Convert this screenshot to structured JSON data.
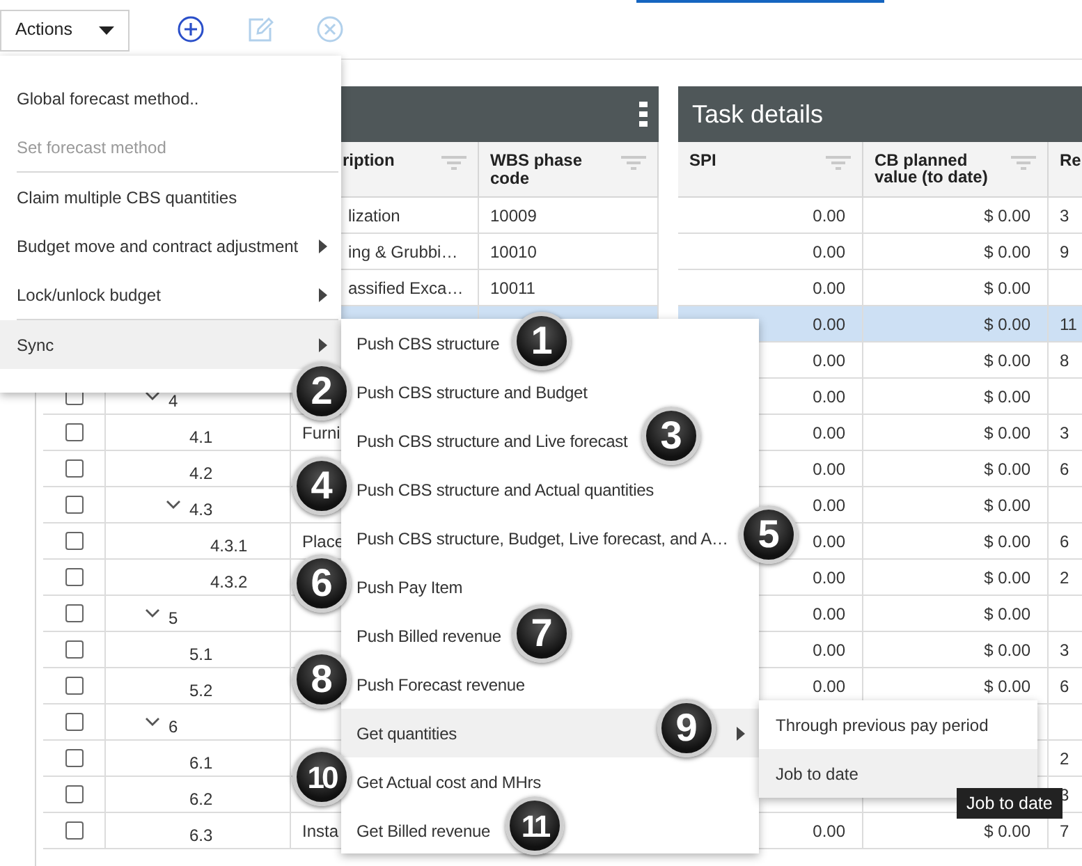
{
  "toolbar": {
    "actions_label": "Actions",
    "icons": [
      {
        "kind": "add",
        "disabled": false
      },
      {
        "kind": "edit",
        "disabled": true
      },
      {
        "kind": "remove",
        "disabled": true
      }
    ]
  },
  "cbs_panel": {
    "columns": [
      {
        "label": "ription",
        "filter": true
      },
      {
        "label": "WBS phase code",
        "filter": true
      }
    ],
    "rows": [
      {
        "description": "lization",
        "code": "10009"
      },
      {
        "description": "ing & Grubbi…",
        "code": "10010"
      },
      {
        "description": "assified Exca…",
        "code": "10011"
      },
      {},
      {},
      {
        "wbs": "4",
        "expanded": true,
        "checked": false,
        "children": [
          {
            "wbs": "4.1",
            "description": "Furni",
            "checked": false
          },
          {
            "wbs": "4.2",
            "checked": false
          },
          {
            "wbs": "4.3",
            "expanded": true,
            "checked": false,
            "children": [
              {
                "wbs": "4.3.1",
                "description": "Place",
                "checked": false
              },
              {
                "wbs": "4.3.2",
                "checked": false
              }
            ]
          }
        ]
      },
      {
        "wbs": "5",
        "expanded": true,
        "checked": false,
        "children": [
          {
            "wbs": "5.1",
            "checked": false
          },
          {
            "wbs": "5.2",
            "checked": false
          }
        ]
      },
      {
        "wbs": "6",
        "expanded": true,
        "checked": false,
        "children": [
          {
            "wbs": "6.1",
            "checked": false
          },
          {
            "wbs": "6.2",
            "checked": false
          },
          {
            "wbs": "6.3",
            "description": "Insta",
            "checked": false
          }
        ]
      }
    ]
  },
  "task_panel": {
    "title": "Task details",
    "columns": [
      {
        "label": "SPI",
        "filter": true
      },
      {
        "label": "CB planned value (to date)",
        "filter": true
      },
      {
        "label": "Re",
        "filter": false
      }
    ],
    "rows": [
      {
        "spi": "0.00",
        "planned": "$ 0.00",
        "re": "3",
        "selected": false
      },
      {
        "spi": "0.00",
        "planned": "$ 0.00",
        "re": "9",
        "selected": false
      },
      {
        "spi": "0.00",
        "planned": "$ 0.00",
        "selected": false
      },
      {
        "spi": "0.00",
        "planned": "$ 0.00",
        "re": "11",
        "selected": true
      },
      {
        "spi": "0.00",
        "planned": "$ 0.00",
        "re": "8",
        "selected": false
      },
      {
        "spi": "0.00",
        "planned": "$ 0.00",
        "selected": false
      },
      {
        "spi": "0.00",
        "planned": "$ 0.00",
        "re": "3",
        "selected": false
      },
      {
        "spi": "0.00",
        "planned": "$ 0.00",
        "re": "6",
        "selected": false
      },
      {
        "spi": "0.00",
        "planned": "$ 0.00",
        "selected": false
      },
      {
        "spi": "0.00",
        "planned": "$ 0.00",
        "re": "6",
        "selected": false
      },
      {
        "spi": "0.00",
        "planned": "$ 0.00",
        "re": "2",
        "selected": false
      },
      {
        "spi": "0.00",
        "planned": "$ 0.00",
        "selected": false
      },
      {
        "spi": "0.00",
        "planned": "$ 0.00",
        "re": "3",
        "selected": false
      },
      {
        "spi": "0.00",
        "planned": "$ 0.00",
        "re": "6",
        "selected": false
      },
      {
        "selected": false
      },
      {
        "re": "2",
        "selected": false
      },
      {
        "re": "3",
        "selected": false
      },
      {
        "spi": "0.00",
        "planned": "$ 0.00",
        "re": "7",
        "selected": false
      }
    ]
  },
  "actions_menu": {
    "items": [
      {
        "kind": "item",
        "label": "Global forecast method..",
        "disabled": false,
        "submenu": false,
        "highlighted": false
      },
      {
        "kind": "item",
        "label": "Set forecast method",
        "disabled": true,
        "submenu": false,
        "highlighted": false
      },
      {
        "kind": "divider"
      },
      {
        "kind": "item",
        "label": "Claim multiple CBS quantities",
        "disabled": false,
        "submenu": false,
        "highlighted": false
      },
      {
        "kind": "item",
        "label": "Budget move and contract adjustment",
        "disabled": false,
        "submenu": true,
        "highlighted": false
      },
      {
        "kind": "item",
        "label": "Lock/unlock budget",
        "disabled": false,
        "submenu": true,
        "highlighted": false
      },
      {
        "kind": "divider"
      },
      {
        "kind": "item",
        "label": "Sync",
        "disabled": false,
        "submenu": true,
        "highlighted": true
      }
    ]
  },
  "sync_menu": {
    "items": [
      {
        "label": "Push CBS structure",
        "submenu": false,
        "highlighted": false
      },
      {
        "label": "Push CBS structure and Budget",
        "submenu": false,
        "highlighted": false
      },
      {
        "label": "Push CBS structure and Live forecast",
        "submenu": false,
        "highlighted": false
      },
      {
        "label": "Push CBS structure and Actual quantities",
        "submenu": false,
        "highlighted": false
      },
      {
        "label": "Push CBS structure, Budget, Live forecast, and A…",
        "submenu": false,
        "highlighted": false
      },
      {
        "label": "Push Pay Item",
        "submenu": false,
        "highlighted": false
      },
      {
        "label": "Push Billed revenue",
        "submenu": false,
        "highlighted": false
      },
      {
        "label": "Push Forecast revenue",
        "submenu": false,
        "highlighted": false
      },
      {
        "label": "Get quantities",
        "submenu": true,
        "highlighted": true
      },
      {
        "label": "Get Actual cost and MHrs",
        "submenu": false,
        "highlighted": false
      },
      {
        "label": "Get Billed revenue",
        "submenu": false,
        "highlighted": false
      }
    ]
  },
  "quantities_menu": {
    "items": [
      {
        "label": "Through previous pay period",
        "highlighted": false
      },
      {
        "label": "Job to date",
        "highlighted": true
      }
    ]
  },
  "tooltip": "Job to date",
  "callouts": [
    {
      "number": "1"
    },
    {
      "number": "2"
    },
    {
      "number": "3"
    },
    {
      "number": "4"
    },
    {
      "number": "5"
    },
    {
      "number": "6"
    },
    {
      "number": "7"
    },
    {
      "number": "8"
    },
    {
      "number": "9"
    },
    {
      "number": "10"
    },
    {
      "number": "11"
    }
  ]
}
